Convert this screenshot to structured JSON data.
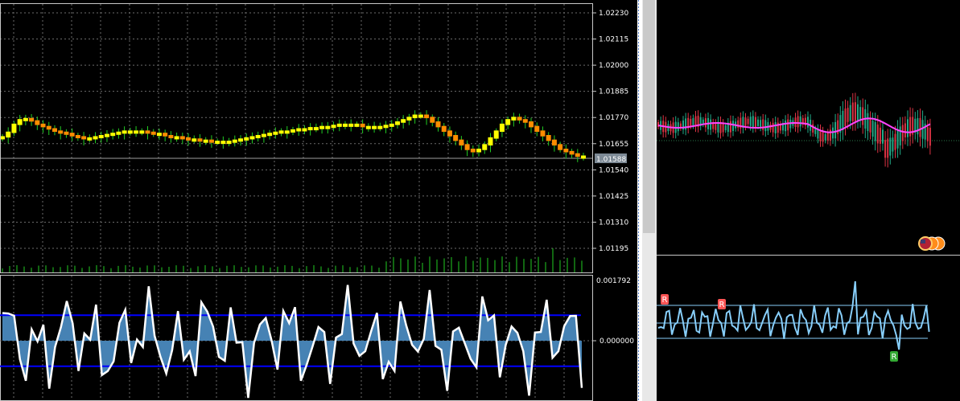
{
  "left_chart": {
    "price_axis_labels": [
      "1.02230",
      "1.02115",
      "1.02000",
      "1.01885",
      "1.01770",
      "1.01655",
      "1.01540",
      "1.01425",
      "1.01310",
      "1.01195"
    ],
    "current_price_label": "1.01588",
    "indicator_axis_labels": [
      "0.001792",
      "0.000000"
    ],
    "colors": {
      "grid": "#6b6b6b",
      "bull": "#ffff00",
      "bear": "#ff8c00",
      "wick": "#22cc22",
      "volume": "#22cc22",
      "osc_line": "#ffffff",
      "osc_fill": "#4682b4",
      "level": "#0000ff"
    }
  },
  "right_chart": {
    "signal_marks": [
      "R",
      "R",
      "R"
    ],
    "colors": {
      "bull": "#22aa88",
      "bear": "#dd3344",
      "ma": "#ff44ff",
      "band": "#87cefa",
      "signal_red": "#ff5555",
      "signal_green": "#33aa33"
    }
  },
  "chart_data": [
    {
      "type": "candlestick",
      "title": "",
      "y_ticks": [
        1.0223,
        1.02115,
        1.02,
        1.01885,
        1.0177,
        1.01655,
        1.0154,
        1.01425,
        1.0131,
        1.01195
      ],
      "ylim": [
        1.0112,
        1.0227
      ],
      "current_price": 1.01588,
      "grid": true,
      "close": [
        1.01685,
        1.01705,
        1.0174,
        1.0176,
        1.01765,
        1.01755,
        1.0174,
        1.0173,
        1.0172,
        1.0171,
        1.01705,
        1.017,
        1.0169,
        1.01685,
        1.0168,
        1.0168,
        1.01685,
        1.0169,
        1.01695,
        1.017,
        1.01705,
        1.0171,
        1.0171,
        1.0171,
        1.0171,
        1.01705,
        1.017,
        1.017,
        1.0169,
        1.01685,
        1.01685,
        1.0168,
        1.01675,
        1.01675,
        1.0167,
        1.0167,
        1.01665,
        1.01665,
        1.01665,
        1.01665,
        1.0167,
        1.01675,
        1.0168,
        1.01685,
        1.0169,
        1.01695,
        1.017,
        1.01705,
        1.0171,
        1.0171,
        1.01715,
        1.0172,
        1.0172,
        1.01725,
        1.01725,
        1.0173,
        1.0173,
        1.01735,
        1.0174,
        1.0174,
        1.0174,
        1.0174,
        1.0173,
        1.0173,
        1.0173,
        1.0173,
        1.01735,
        1.0174,
        1.0175,
        1.0176,
        1.0177,
        1.0178,
        1.0178,
        1.0177,
        1.0175,
        1.0173,
        1.0171,
        1.0169,
        1.0167,
        1.0165,
        1.0163,
        1.0162,
        1.0163,
        1.0165,
        1.0168,
        1.0171,
        1.0174,
        1.0176,
        1.0177,
        1.0176,
        1.0175,
        1.0173,
        1.0171,
        1.0169,
        1.0167,
        1.0165,
        1.0163,
        1.0162,
        1.0161,
        1.016,
        1.016
      ],
      "oscillator": {
        "ylim_top_label": 0.001792,
        "zero": 0.0,
        "upper_level": 0.00075,
        "lower_level": -0.00075
      }
    },
    {
      "type": "candlestick",
      "title": "",
      "grid": false
    }
  ]
}
